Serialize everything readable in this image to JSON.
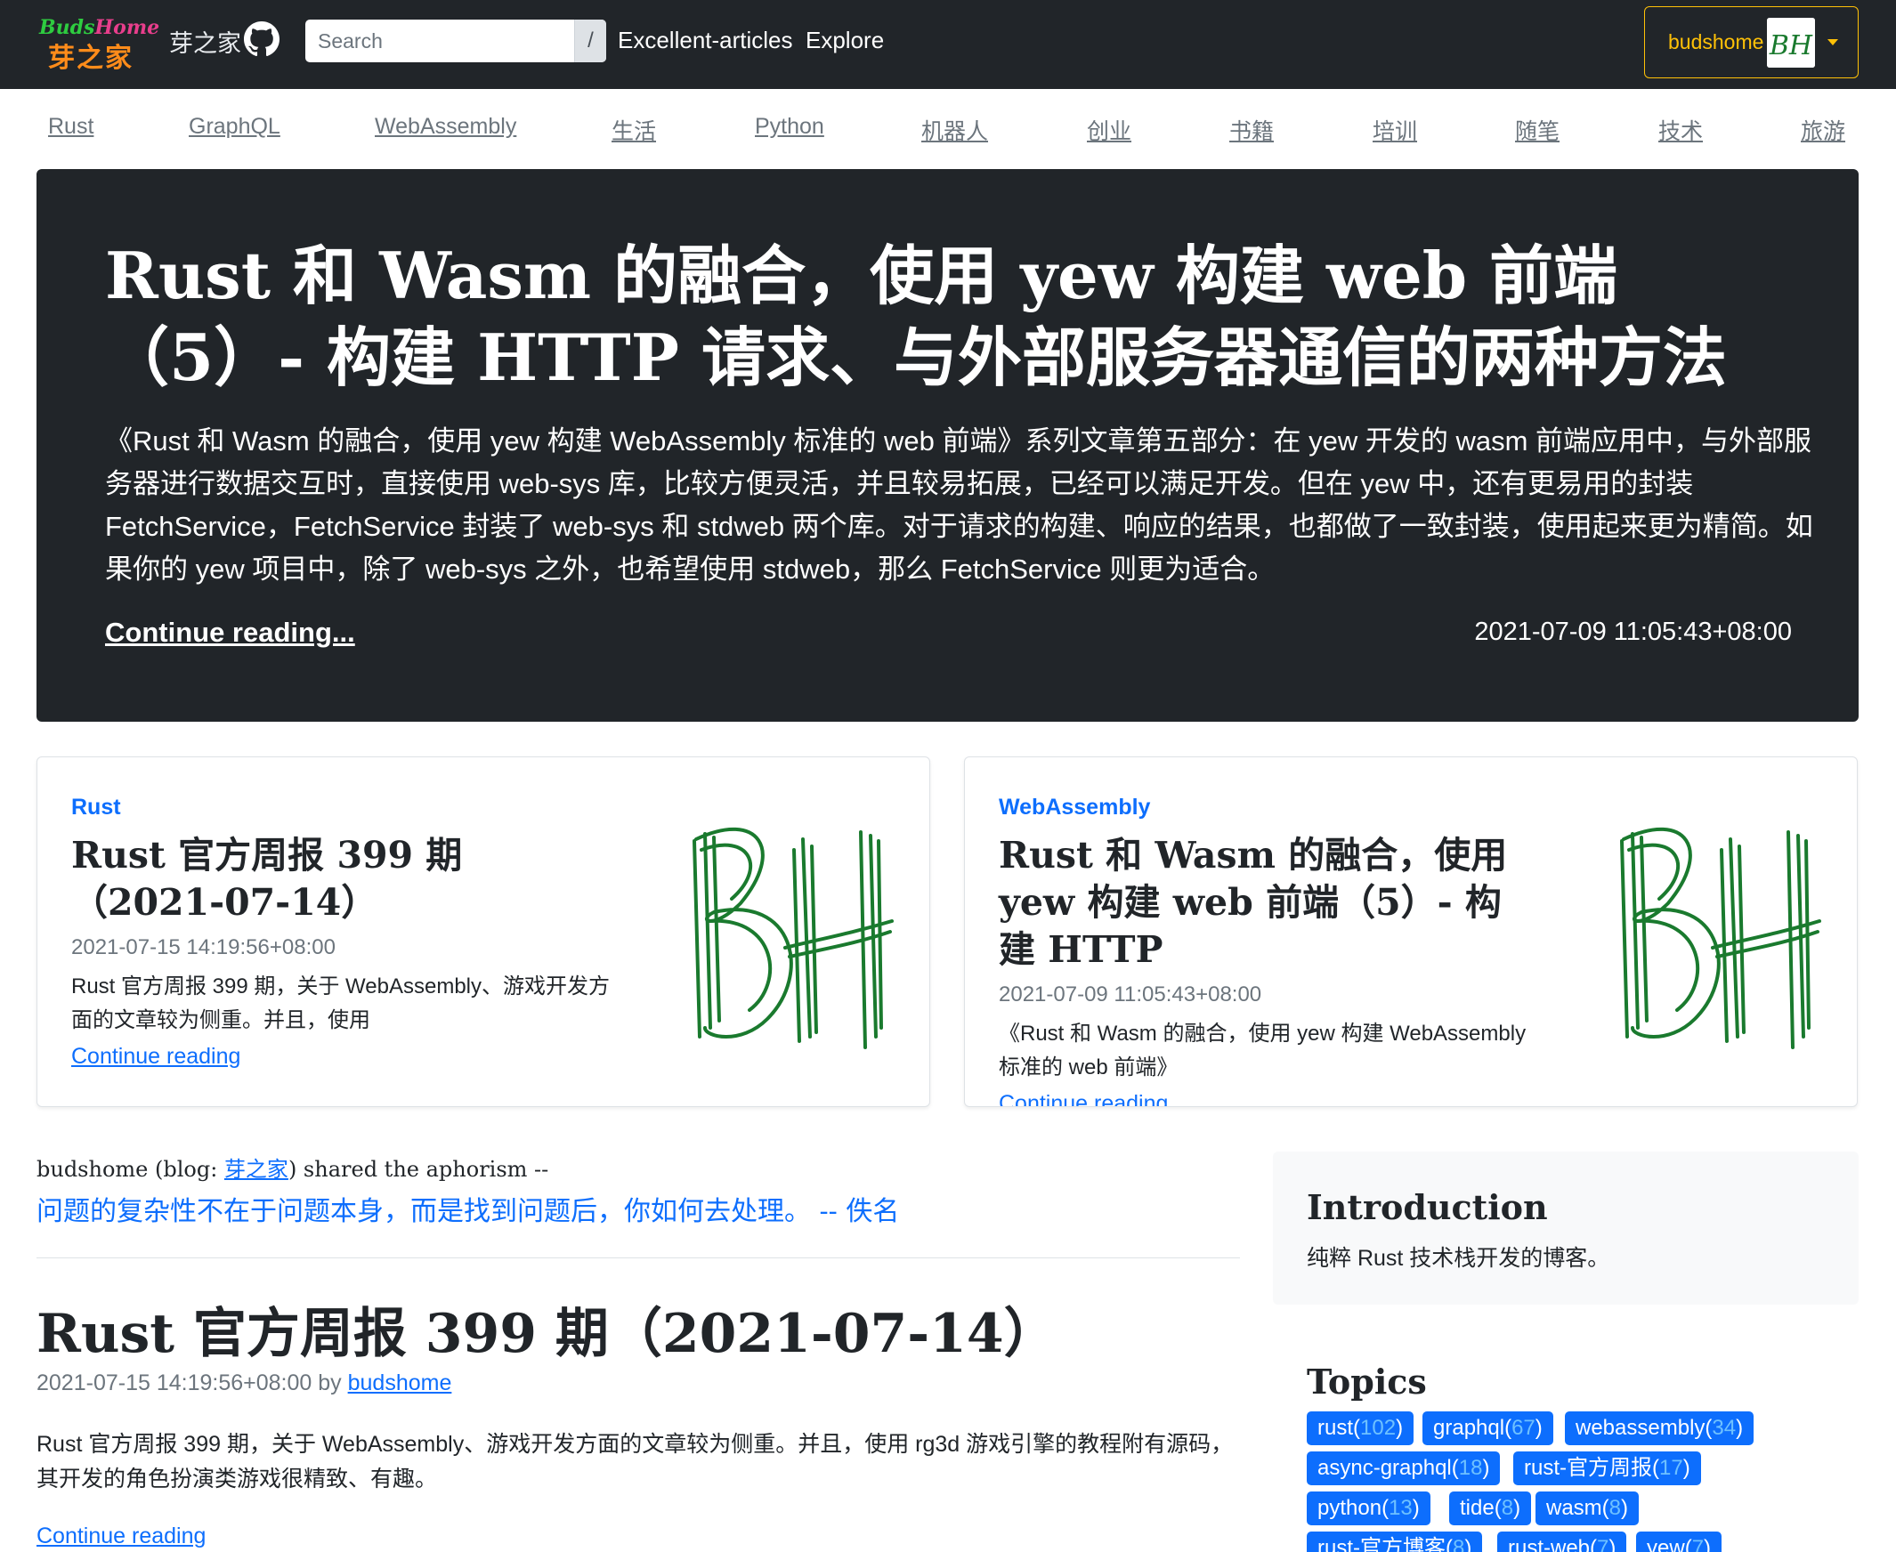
{
  "navbar": {
    "logo_top_a": "Buds",
    "logo_top_b": "Home",
    "logo_bottom": "芽之家",
    "site_name": "芽之家",
    "search_placeholder": "Search",
    "search_shortcut": "/",
    "links": [
      "Excellent-articles",
      "Explore"
    ],
    "username": "budshome",
    "avatar_text": "BH"
  },
  "categories": [
    "Rust",
    "GraphQL",
    "WebAssembly",
    "生活",
    "Python",
    "机器人",
    "创业",
    "书籍",
    "培训",
    "随笔",
    "技术",
    "旅游"
  ],
  "hero": {
    "title": "Rust 和 Wasm 的融合，使用 yew 构建 web 前端（5）- 构建 HTTP 请求、与外部服务器通信的两种方法",
    "summary": "《Rust 和 Wasm 的融合，使用 yew 构建 WebAssembly 标准的 web 前端》系列文章第五部分：在 yew 开发的 wasm 前端应用中，与外部服务器进行数据交互时，直接使用 web-sys 库，比较方便灵活，并且较易拓展，已经可以满足开发。但在 yew 中，还有更易用的封装 FetchService，FetchService 封装了 web-sys 和 stdweb 两个库。对于请求的构建、响应的结果，也都做了一致封装，使用起来更为精简。如果你的 yew 项目中，除了 web-sys 之外，也希望使用 stdweb，那么 FetchService 则更为适合。",
    "more": "Continue reading...",
    "date": "2021-07-09 11:05:43+08:00"
  },
  "cards": [
    {
      "category": "Rust",
      "title": "Rust 官方周报 399 期（2021-07-14）",
      "date": "2021-07-15 14:19:56+08:00",
      "desc": "Rust 官方周报 399 期，关于 WebAssembly、游戏开发方面的文章较为侧重。并且，使用",
      "more": "Continue reading"
    },
    {
      "category": "WebAssembly",
      "title": "Rust 和 Wasm 的融合，使用 yew 构建 web 前端（5）- 构建 HTTP",
      "date": "2021-07-09 11:05:43+08:00",
      "desc": "《Rust 和 Wasm 的融合，使用 yew 构建 WebAssembly 标准的 web 前端》",
      "more": "Continue reading"
    }
  ],
  "aphorism": {
    "prefix": "budshome (blog: ",
    "blog": "芽之家",
    "suffix": ") shared the aphorism --",
    "quote": "问题的复杂性不在于问题本身，而是找到问题后，你如何去处理。 -- 佚名"
  },
  "post": {
    "title": "Rust 官方周报 399 期（2021-07-14）",
    "date": "2021-07-15 14:19:56+08:00",
    "by": " by ",
    "author": "budshome",
    "desc": "Rust 官方周报 399 期，关于 WebAssembly、游戏开发方面的文章较为侧重。并且，使用 rg3d 游戏引擎的教程附有源码，其开发的角色扮演类游戏很精致、有趣。",
    "more": "Continue reading"
  },
  "sidebar": {
    "intro_title": "Introduction",
    "intro_text": "纯粹 Rust 技术栈开发的博客。",
    "topics_title": "Topics",
    "topics": [
      {
        "name": "rust",
        "count": "102"
      },
      {
        "name": "graphql",
        "count": "67"
      },
      {
        "name": "webassembly",
        "count": "34"
      },
      {
        "name": "async-graphql",
        "count": "18"
      },
      {
        "name": "rust-官方周报",
        "count": "17"
      },
      {
        "name": "python",
        "count": "13"
      },
      {
        "name": "tide",
        "count": "8"
      },
      {
        "name": "wasm",
        "count": "8"
      },
      {
        "name": "rust-官方博客",
        "count": "8"
      },
      {
        "name": "rust-web",
        "count": "7"
      },
      {
        "name": "yew",
        "count": "7"
      }
    ]
  },
  "colors": {
    "navbar_bg": "#212529",
    "accent": "#0d6efd",
    "warning": "#ffc107",
    "logo_green": "#1a7a2e"
  }
}
